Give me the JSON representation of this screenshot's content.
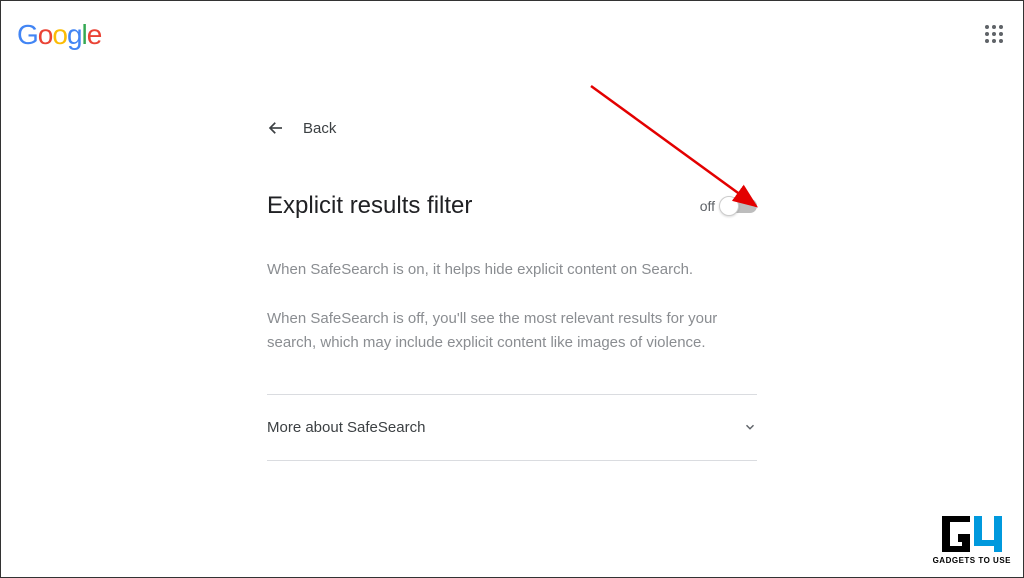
{
  "header": {
    "logo_text": "Google"
  },
  "back": {
    "label": "Back"
  },
  "page": {
    "title": "Explicit results filter",
    "toggle_state": "off",
    "description_on": "When SafeSearch is on, it helps hide explicit content on Search.",
    "description_off": "When SafeSearch is off, you'll see the most relevant results for your search, which may include explicit content like images of violence."
  },
  "expander": {
    "label": "More about SafeSearch"
  },
  "watermark": {
    "text": "GADGETS TO USE"
  }
}
